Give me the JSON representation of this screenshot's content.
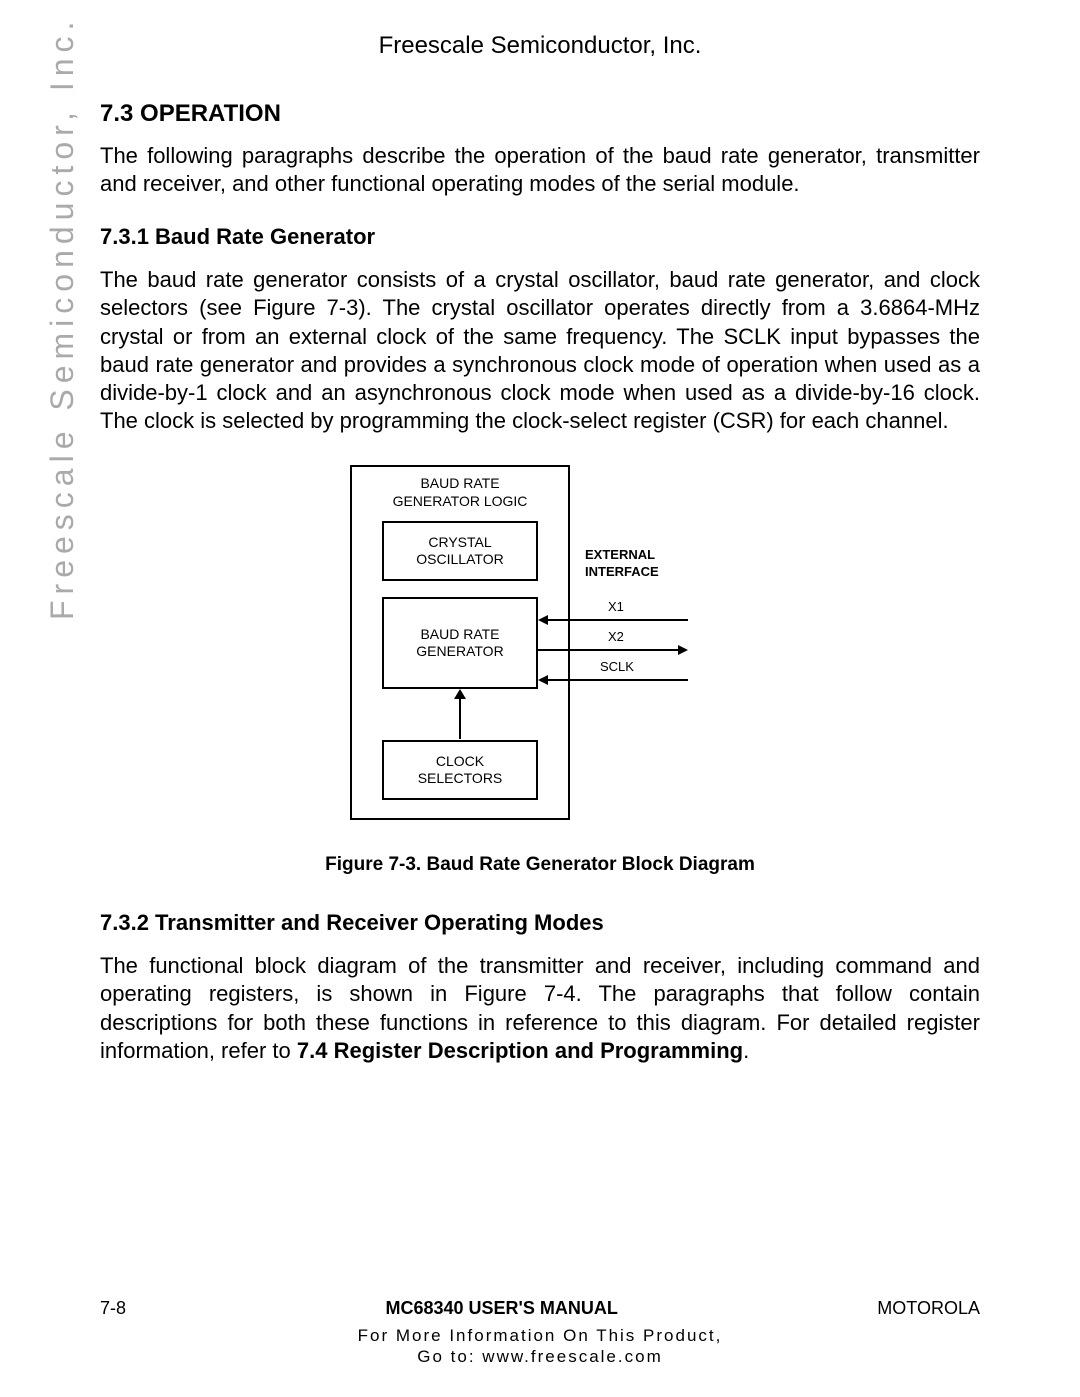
{
  "header": {
    "company": "Freescale Semiconductor, Inc."
  },
  "watermark": "Freescale Semiconductor, Inc.",
  "section": {
    "num_title": "7.3 OPERATION",
    "intro": "The following paragraphs describe the operation of the baud rate generator, transmitter and receiver, and other functional operating modes of the serial module."
  },
  "sub1": {
    "num_title": "7.3.1 Baud Rate Generator",
    "para": "The baud rate generator consists of a crystal oscillator, baud rate generator, and clock selectors (see Figure 7-3). The crystal oscillator operates directly from a 3.6864-MHz crystal or from an external clock of the same frequency. The SCLK input bypasses the baud rate generator and provides a synchronous clock mode of operation when used as a divide-by-1 clock and an asynchronous clock mode when used as a divide-by-16 clock. The clock is selected by programming the clock-select register (CSR) for each channel."
  },
  "diagram": {
    "top_label_l1": "BAUD RATE",
    "top_label_l2": "GENERATOR LOGIC",
    "box_crystal_l1": "CRYSTAL",
    "box_crystal_l2": "OSCILLATOR",
    "box_brg_l1": "BAUD RATE",
    "box_brg_l2": "GENERATOR",
    "box_clk_l1": "CLOCK",
    "box_clk_l2": "SELECTORS",
    "ext_l1": "EXTERNAL",
    "ext_l2": "INTERFACE",
    "sig_x1": "X1",
    "sig_x2": "X2",
    "sig_sclk": "SCLK"
  },
  "figure_caption": "Figure 7-3. Baud Rate Generator Block Diagram",
  "sub2": {
    "num_title": "7.3.2 Transmitter and Receiver Operating Modes",
    "para_before_bold": "The functional block diagram of the transmitter and receiver, including command and operating registers, is shown in Figure 7-4. The paragraphs that follow contain descriptions for both these functions in reference to this diagram. For detailed register information, refer to ",
    "bold_ref": "7.4 Register Description and Programming",
    "para_after_bold": "."
  },
  "footer": {
    "page": "7-8",
    "manual": "MC68340 USER'S MANUAL",
    "brand": "MOTOROLA",
    "info_l1": "For More Information On This Product,",
    "info_l2": "Go to: www.freescale.com"
  }
}
